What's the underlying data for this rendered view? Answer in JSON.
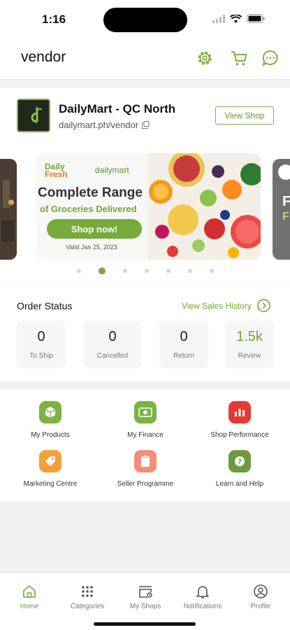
{
  "status_bar": {
    "time": "1:16"
  },
  "header": {
    "title": "vendor",
    "icons": [
      "gear-icon",
      "cart-icon",
      "chat-icon"
    ]
  },
  "shop": {
    "name": "DailyMart - QC North",
    "url": "dailymart.ph/vendor",
    "view_shop_label": "View Shop"
  },
  "banner": {
    "brand_daily": "Daily",
    "brand_fresh": "Fresh",
    "brand_mart": "dailymart",
    "headline": "Complete Range",
    "subheadline": "of Groceries Delivered",
    "cta_label": "Shop now!",
    "valid_text": "Valid Jan 25, 2023",
    "right_peek_letter1": "F",
    "right_peek_letter2": "F",
    "slide_count": 7,
    "active_slide": 2
  },
  "order_status": {
    "title": "Order Status",
    "history_link": "View Sales History",
    "stats": [
      {
        "value": "0",
        "label": "To Ship"
      },
      {
        "value": "0",
        "label": "Cancelled"
      },
      {
        "value": "0",
        "label": "Return"
      },
      {
        "value": "1.5k",
        "label": "Review"
      }
    ]
  },
  "shortcuts": [
    {
      "label": "My Products",
      "icon": "box-icon",
      "color": "#7cb342"
    },
    {
      "label": "My Finance",
      "icon": "money-icon",
      "color": "#7cb342"
    },
    {
      "label": "Shop Performance",
      "icon": "bar-chart-icon",
      "color": "#e53935"
    },
    {
      "label": "Marketing Centre",
      "icon": "tag-icon",
      "color": "#f5a03a"
    },
    {
      "label": "Seller Programme",
      "icon": "clipboard-icon",
      "color": "#f0907a"
    },
    {
      "label": "Learn and Help",
      "icon": "help-icon",
      "color": "#6e9a3f"
    }
  ],
  "bottom_nav": [
    {
      "label": "Home",
      "icon": "home-icon",
      "active": true
    },
    {
      "label": "Categories",
      "icon": "grid-icon",
      "active": false
    },
    {
      "label": "My Shops",
      "icon": "shop-icon",
      "active": false
    },
    {
      "label": "Notifications",
      "icon": "bell-icon",
      "active": false
    },
    {
      "label": "Profile",
      "icon": "profile-icon",
      "active": false
    }
  ],
  "colors": {
    "accent": "#7cb342",
    "accent_text": "#6ea830"
  }
}
